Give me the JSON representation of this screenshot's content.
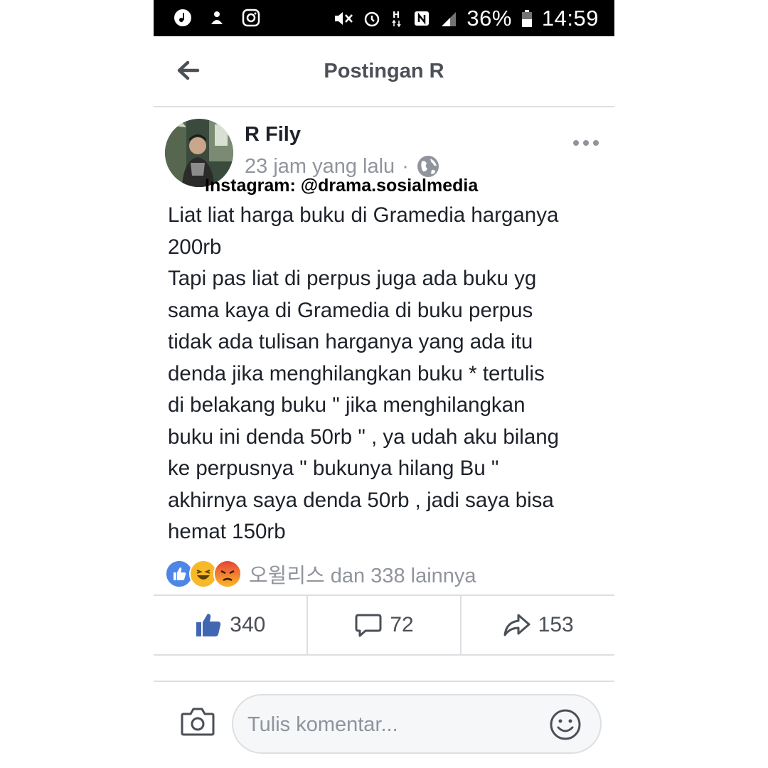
{
  "status_bar": {
    "battery": "36%",
    "time": "14:59",
    "icons": [
      "music-icon",
      "person-icon",
      "instagram-icon",
      "mute-icon",
      "alarm-icon",
      "hplus-icon",
      "nfc-icon",
      "signal-icon",
      "battery-icon"
    ]
  },
  "header": {
    "title": "Postingan R",
    "back_icon": "arrow-left-icon"
  },
  "post": {
    "author": "R Fily",
    "time": "23 jam yang lalu",
    "separator": "·",
    "privacy_icon": "globe-icon",
    "watermark": "Instagram: @drama.sosialmedia",
    "text_lines": [
      "Liat liat harga buku di Gramedia harganya",
      "200rb",
      "Tapi pas liat di perpus juga ada buku yg",
      "sama kaya di Gramedia di buku perpus",
      "tidak ada tulisan harganya yang ada itu",
      "denda jika menghilangkan buku * tertulis",
      "di belakang buku \" jika menghilangkan",
      "buku ini denda 50rb \" , ya udah aku bilang",
      "ke perpusnya \" bukunya hilang Bu \"",
      "akhirnya saya denda 50rb , jadi saya bisa",
      "hemat 150rb"
    ],
    "reactions": {
      "icons": [
        "like-reaction-icon",
        "haha-reaction-icon",
        "angry-reaction-icon"
      ],
      "summary": "오윌리스 dan 338 lainnya"
    }
  },
  "actions": {
    "likes": "340",
    "comments": "72",
    "shares": "153"
  },
  "composer": {
    "placeholder": "Tulis komentar..."
  },
  "colors": {
    "fb_blue": "#4267b2",
    "meta_gray": "#90949c",
    "divider": "#dddfe2"
  }
}
